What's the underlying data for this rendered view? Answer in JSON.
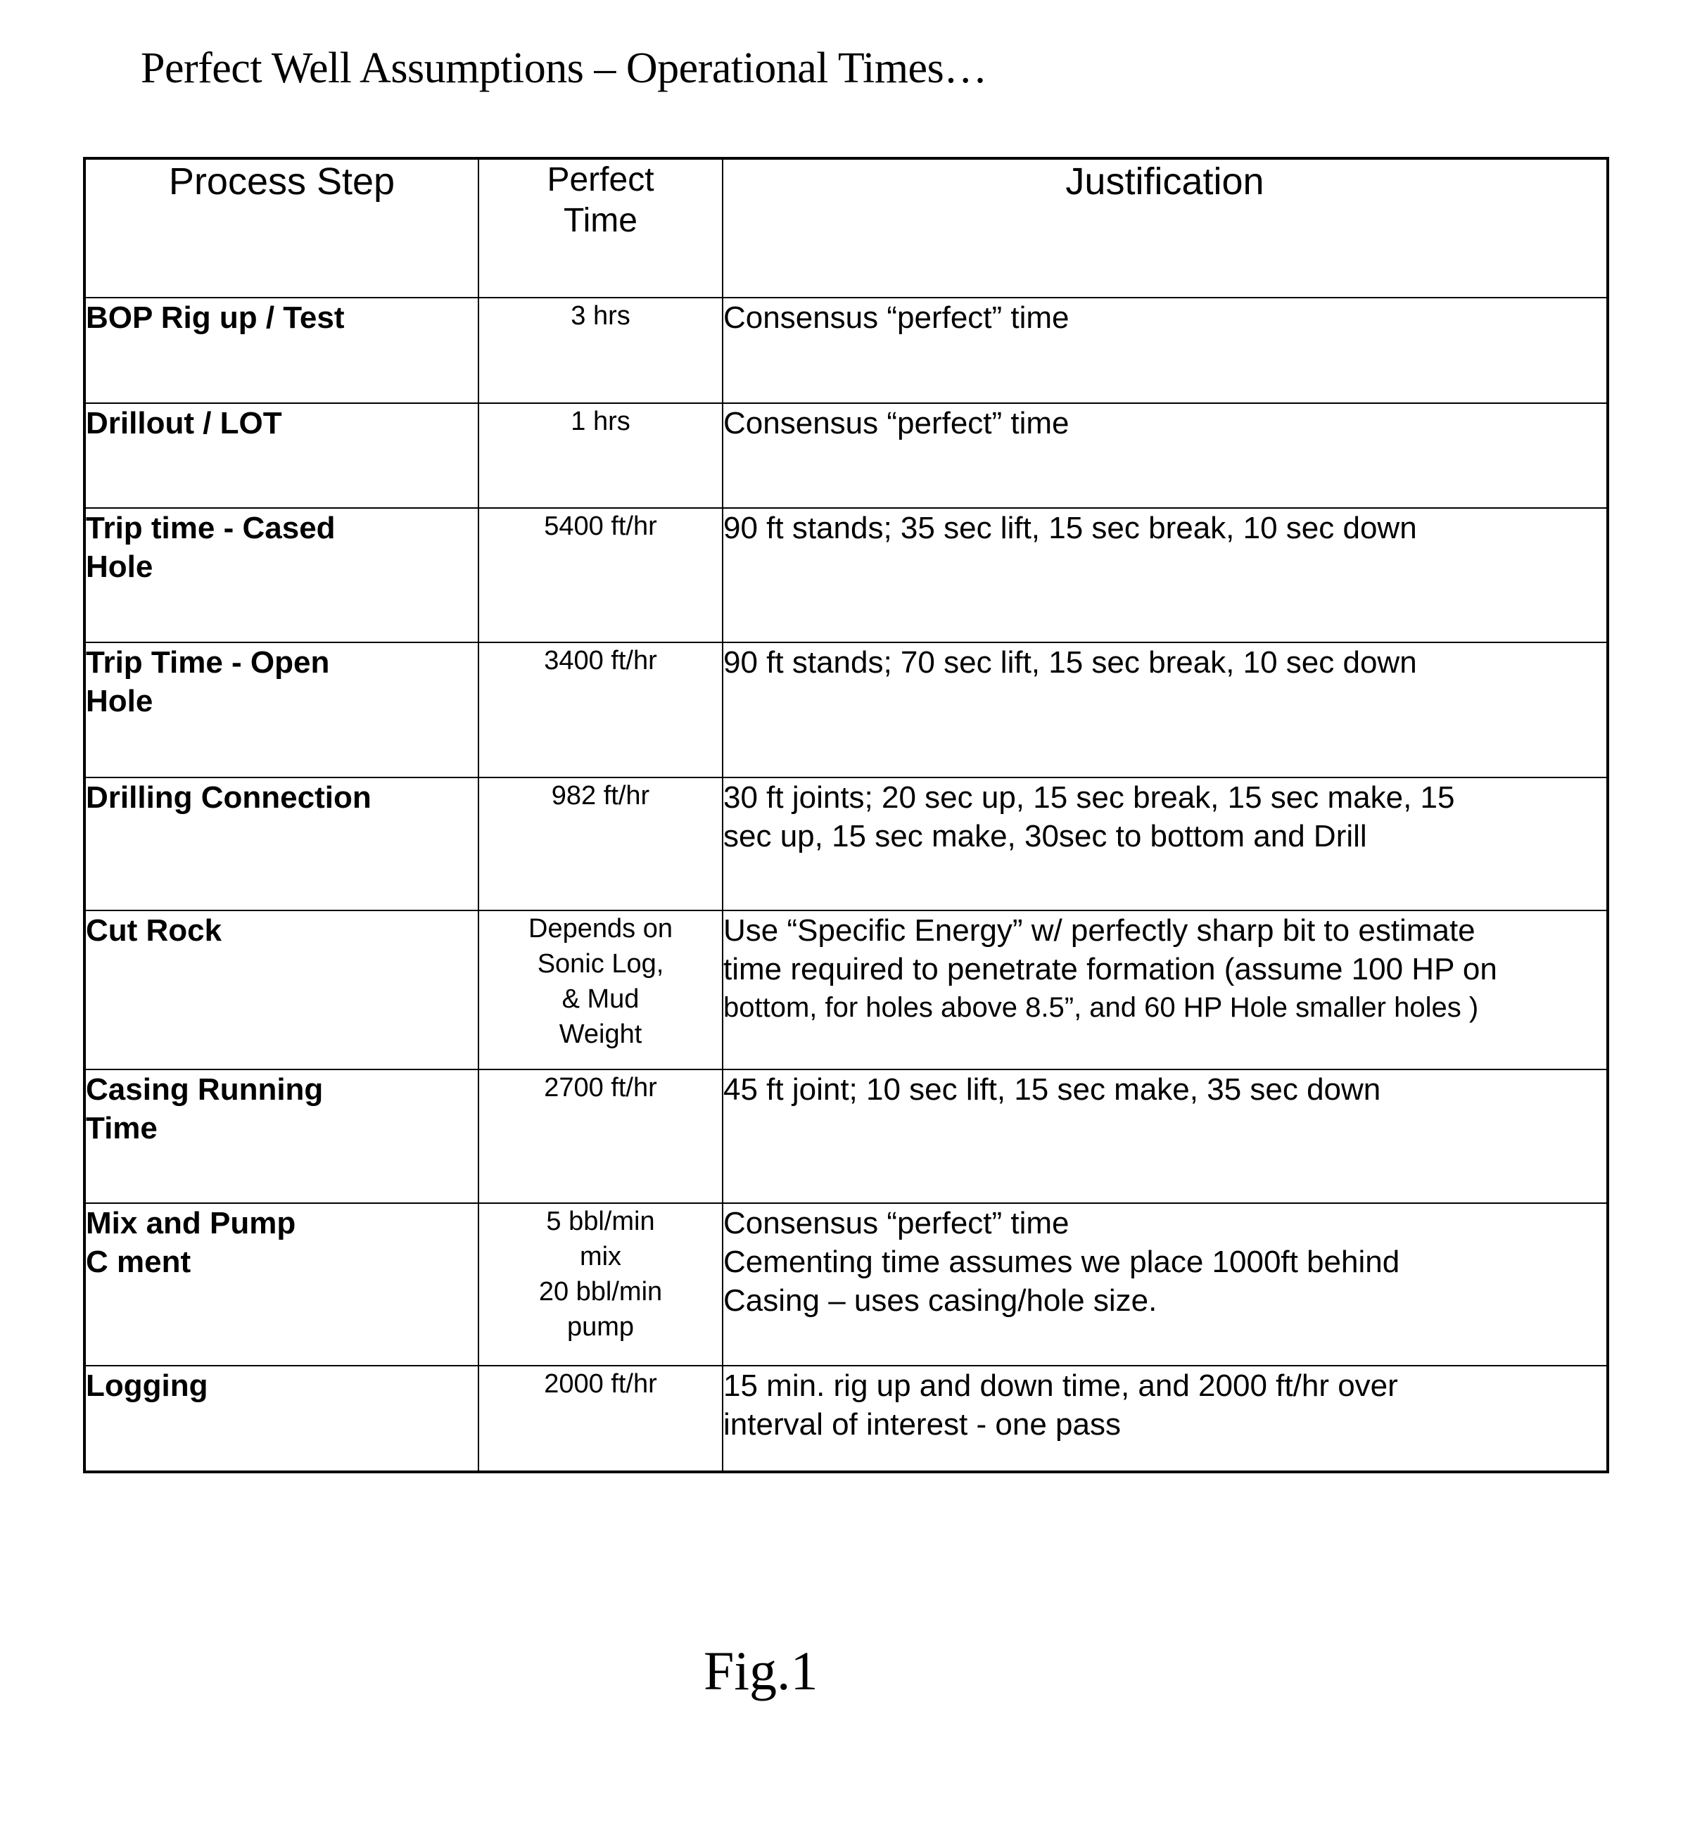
{
  "title": "Perfect Well Assumptions – Operational Times…",
  "table": {
    "headers": {
      "process_step": "Process Step",
      "perfect_time": [
        "Perfect",
        "Time"
      ],
      "justification": "Justification"
    },
    "rows": [
      {
        "step": [
          "BOP Rig up / Test"
        ],
        "time": [
          "3 hrs"
        ],
        "justification": [
          "Consensus “perfect” time"
        ]
      },
      {
        "step": [
          "Drillout / LOT"
        ],
        "time": [
          "1 hrs"
        ],
        "justification": [
          "Consensus “perfect” time"
        ]
      },
      {
        "step": [
          "Trip time - Cased",
          "Hole"
        ],
        "time": [
          "5400 ft/hr"
        ],
        "justification": [
          "90 ft stands; 35 sec lift, 15 sec break, 10 sec down"
        ]
      },
      {
        "step": [
          "Trip Time - Open",
          "Hole"
        ],
        "time": [
          "3400 ft/hr"
        ],
        "justification": [
          "90 ft stands; 70 sec lift, 15 sec break, 10 sec down"
        ]
      },
      {
        "step": [
          "Drilling Connection"
        ],
        "time": [
          "982 ft/hr"
        ],
        "justification": [
          "30 ft joints; 20 sec up, 15 sec break, 15 sec make, 15",
          "sec up, 15 sec make, 30sec to bottom and Drill"
        ]
      },
      {
        "step": [
          "Cut Rock"
        ],
        "time": [
          "Depends on",
          "Sonic Log,",
          "& Mud",
          "Weight"
        ],
        "justification": [
          "Use “Specific Energy” w/ perfectly sharp bit to estimate",
          "time required to penetrate formation (assume 100 HP on",
          "bottom, for holes above 8.5”, and 60 HP Hole smaller holes )"
        ]
      },
      {
        "step": [
          "Casing Running",
          "Time"
        ],
        "time": [
          "2700 ft/hr"
        ],
        "justification": [
          "45 ft joint; 10 sec lift, 15 sec make, 35 sec down"
        ]
      },
      {
        "step": [
          "Mix and Pump",
          "C  ment"
        ],
        "time": [
          "5 bbl/min",
          "mix",
          "20 bbl/min",
          "pump"
        ],
        "justification": [
          "Consensus “perfect” time",
          "Cementing time assumes we place 1000ft behind",
          "Casing – uses casing/hole size."
        ]
      },
      {
        "step": [
          "Logging"
        ],
        "time": [
          "2000 ft/hr"
        ],
        "justification": [
          "15 min. rig up and down time, and 2000 ft/hr over",
          "interval of interest - one pass"
        ]
      }
    ]
  },
  "figure_label": "Fig.1"
}
